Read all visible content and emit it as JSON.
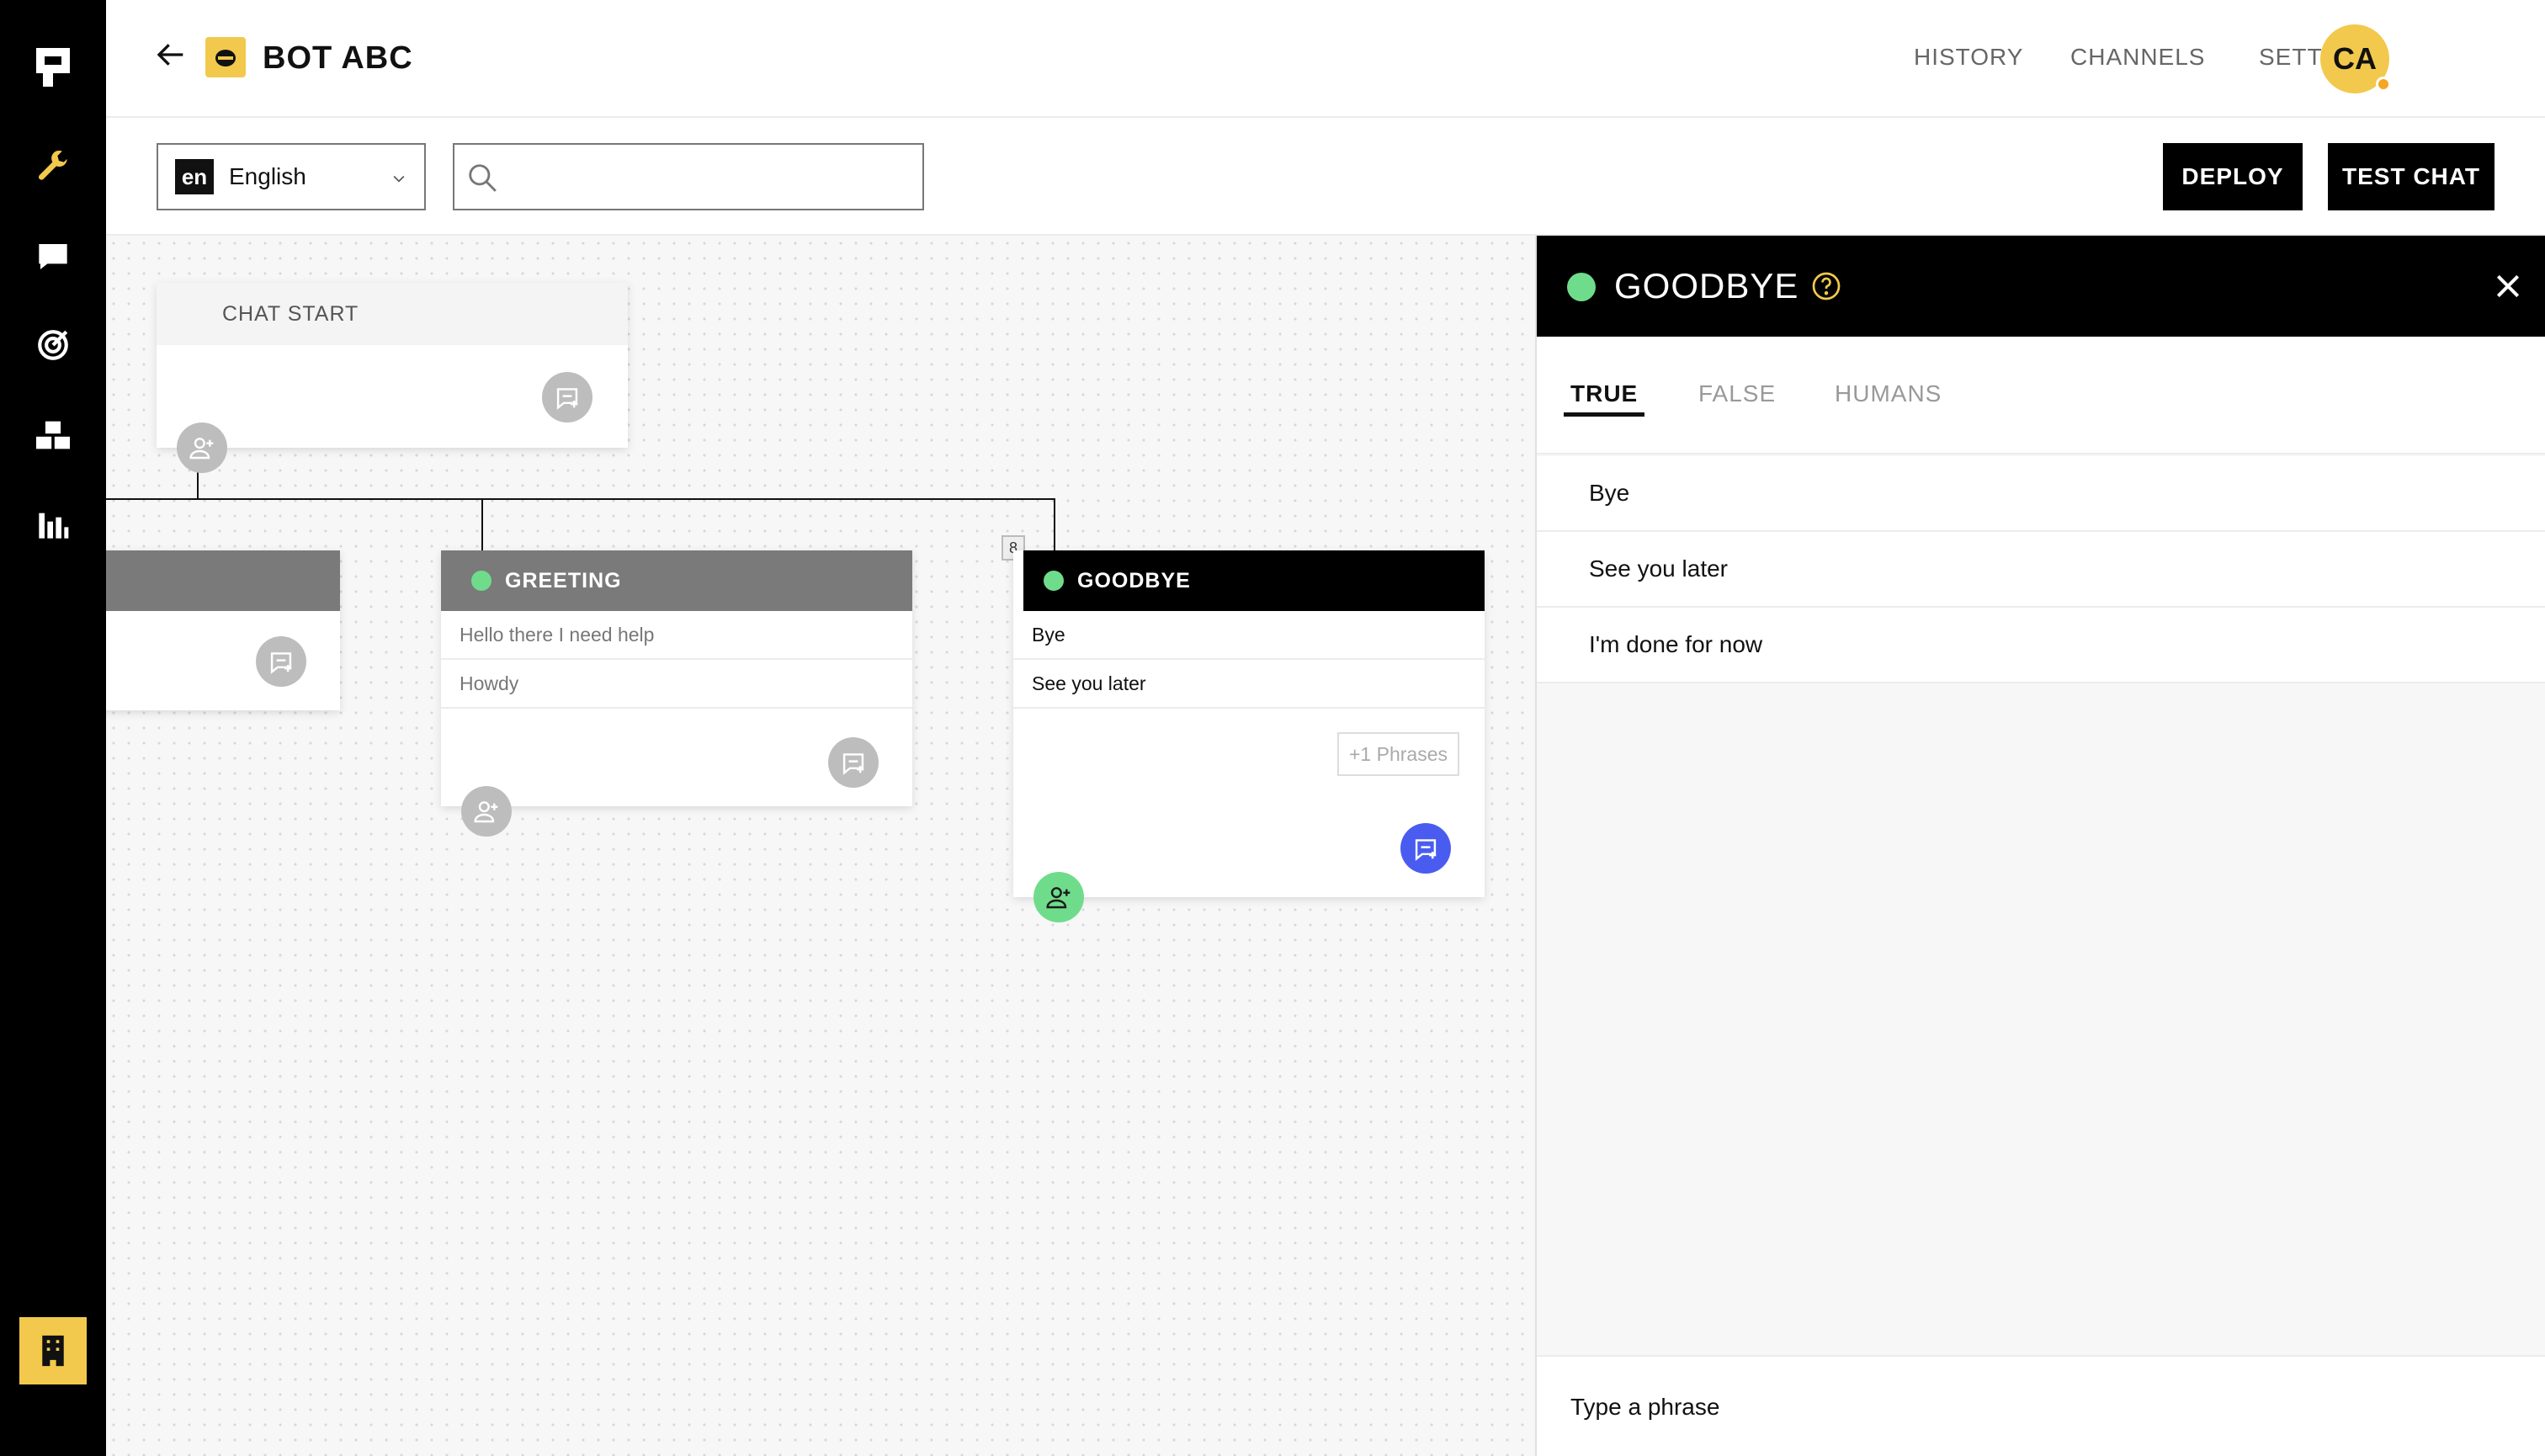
{
  "header": {
    "bot_name": "BOT ABC",
    "nav": [
      "HISTORY",
      "CHANNELS",
      "SETTINGS"
    ],
    "avatar_initials": "CA"
  },
  "toolbar": {
    "language_code": "en",
    "language_name": "English",
    "search_placeholder": "",
    "deploy_label": "DEPLOY",
    "test_chat_label": "TEST CHAT"
  },
  "canvas": {
    "chat_start": {
      "title": "CHAT START"
    },
    "greeting": {
      "title": "GREETING",
      "phrases": [
        "Hello there I need help",
        "Howdy"
      ]
    },
    "goodbye": {
      "title": "GOODBYE",
      "phrases": [
        "Bye",
        "See you later"
      ],
      "more_phrases": "+1 Phrases",
      "badge": "8"
    }
  },
  "panel": {
    "title": "GOODBYE",
    "tabs": [
      "TRUE",
      "FALSE",
      "HUMANS"
    ],
    "active_tab": "TRUE",
    "phrases": [
      "Bye",
      "See you later",
      "I'm done for now"
    ],
    "input_placeholder": "Type a phrase"
  },
  "colors": {
    "accent": "#f2c94c",
    "primary_blue": "#4a5cf0",
    "green": "#6fdc8c",
    "black": "#000000"
  }
}
